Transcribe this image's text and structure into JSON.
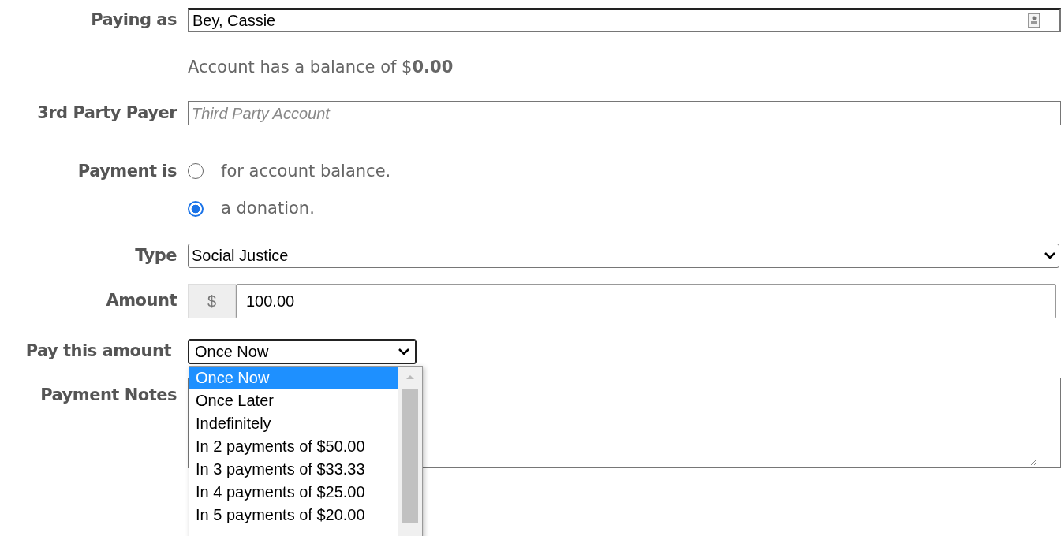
{
  "paying_as": {
    "label": "Paying as",
    "value": "Bey, Cassie"
  },
  "balance_note": "Account has a balance of $**0.00**",
  "third_party": {
    "label": "3rd Party Payer",
    "placeholder": "Third Party Account"
  },
  "payment_is": {
    "label": "Payment is",
    "options": [
      {
        "label": "for account balance.",
        "selected": false
      },
      {
        "label": "a donation.",
        "selected": true
      }
    ]
  },
  "type": {
    "label": "Type",
    "value": "Social Justice"
  },
  "amount": {
    "label": "Amount",
    "prefix": "$",
    "value": "100.00"
  },
  "pay_this_amount": {
    "label": "Pay this amount",
    "value": "Once Now",
    "expanded": true,
    "options": [
      {
        "label": "Once Now",
        "selected": true
      },
      {
        "label": "Once Later",
        "selected": false
      },
      {
        "label": "Indefinitely",
        "selected": false
      },
      {
        "label": "In 2 payments of $50.00",
        "selected": false
      },
      {
        "label": "In 3 payments of $33.33",
        "selected": false
      },
      {
        "label": "In 4 payments of $25.00",
        "selected": false
      },
      {
        "label": "In 5 payments of $20.00",
        "selected": false
      }
    ]
  },
  "payment_notes": {
    "label": "Payment Notes"
  }
}
